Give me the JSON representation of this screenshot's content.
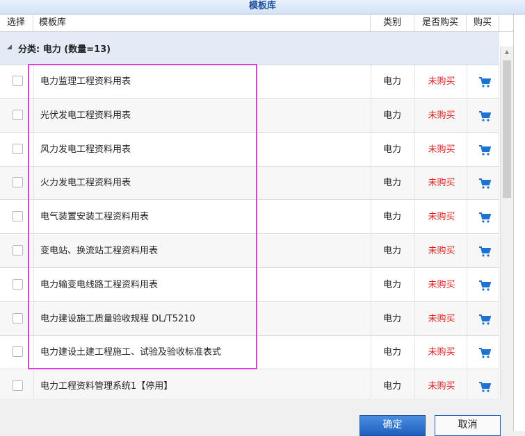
{
  "window": {
    "title": "模板库"
  },
  "table": {
    "columns": {
      "select": "选择",
      "library": "模板库",
      "category": "类别",
      "purchased": "是否购买",
      "buy": "购买"
    },
    "group_label": "分类: 电力 (数量=13)",
    "rows": [
      {
        "name": "电力监理工程资料用表",
        "category": "电力",
        "status": "未购买"
      },
      {
        "name": "光伏发电工程资料用表",
        "category": "电力",
        "status": "未购买"
      },
      {
        "name": "风力发电工程资料用表",
        "category": "电力",
        "status": "未购买"
      },
      {
        "name": "火力发电工程资料用表",
        "category": "电力",
        "status": "未购买"
      },
      {
        "name": "电气装置安装工程资料用表",
        "category": "电力",
        "status": "未购买"
      },
      {
        "name": "变电站、换流站工程资料用表",
        "category": "电力",
        "status": "未购买"
      },
      {
        "name": "电力输变电线路工程资料用表",
        "category": "电力",
        "status": "未购买"
      },
      {
        "name": "电力建设施工质量验收规程 DL/T5210",
        "category": "电力",
        "status": "未购买"
      },
      {
        "name": "电力建设土建工程施工、试验及验收标准表式",
        "category": "电力",
        "status": "未购买"
      },
      {
        "name": "电力工程资料管理系统1【停用】",
        "category": "电力",
        "status": "未购买"
      }
    ]
  },
  "buttons": {
    "ok": "确定",
    "cancel": "取消"
  },
  "colors": {
    "status_red": "#e02020",
    "cart_blue": "#1e73d2",
    "highlight": "#e23be2",
    "group_bg": "#e3ebf6"
  }
}
